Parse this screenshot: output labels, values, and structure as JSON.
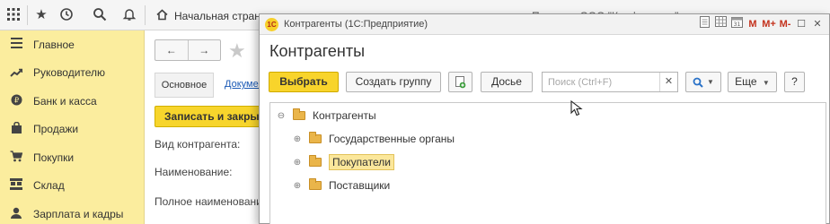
{
  "topbar": {
    "home_tab_label": "Начальная страница",
    "second_tab_label": "Продажи ООО \"Конфетпром\""
  },
  "sidebar": {
    "items": [
      {
        "label": "Главное",
        "icon": "menu-lines-icon"
      },
      {
        "label": "Руководителю",
        "icon": "trend-icon"
      },
      {
        "label": "Банк и касса",
        "icon": "coin-icon"
      },
      {
        "label": "Продажи",
        "icon": "bag-icon"
      },
      {
        "label": "Покупки",
        "icon": "cart-icon"
      },
      {
        "label": "Склад",
        "icon": "warehouse-icon"
      },
      {
        "label": "Зарплата и кадры",
        "icon": "people-icon"
      }
    ]
  },
  "background_form": {
    "tab_main": "Основное",
    "tab_docs": "Документы",
    "save_button": "Записать и закрыть",
    "fields": [
      "Вид контрагента:",
      "Наименование:",
      "Полное наименование:"
    ]
  },
  "window": {
    "title": "Контрагенты  (1С:Предприятие)",
    "heading": "Контрагенты",
    "buttons": {
      "select": "Выбрать",
      "create_group": "Создать группу",
      "dossier": "Досье",
      "more": "Еще",
      "help": "?"
    },
    "search_placeholder": "Поиск (Ctrl+F)",
    "tree": {
      "root": "Контрагенты",
      "children": [
        "Государственные органы",
        "Покупатели",
        "Поставщики"
      ],
      "selected": "Покупатели"
    }
  },
  "colors": {
    "sidebar_bg": "#fbed9e",
    "primary_button": "#f8d42b",
    "folder": "#eab54a",
    "link": "#1a59b5"
  }
}
